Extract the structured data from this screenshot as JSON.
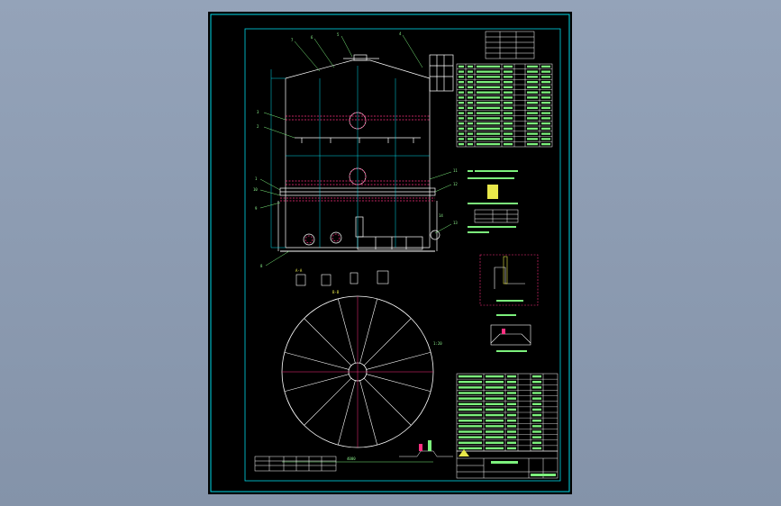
{
  "sheet": {
    "background": "#000000",
    "frame_color": "#00d8e8",
    "line_color": "#ffffff",
    "annotation_color": "#7cf07c",
    "highlight_color": "#ff3080",
    "accent_color": "#e8e84a"
  },
  "callouts": [
    "7",
    "6",
    "5",
    "4",
    "3",
    "2",
    "1",
    "10",
    "9",
    "8",
    "11",
    "12",
    "13",
    "14"
  ],
  "symbols": [
    "1",
    "2",
    "3",
    "4"
  ],
  "labels": {
    "section_left": "A-A",
    "section_right": "B-B",
    "dimension_bottom": "4000",
    "plan_note": "1:20"
  },
  "icons": {
    "title_logo": "triangle-mark-icon",
    "cursor_mark": "cursor-icon"
  }
}
